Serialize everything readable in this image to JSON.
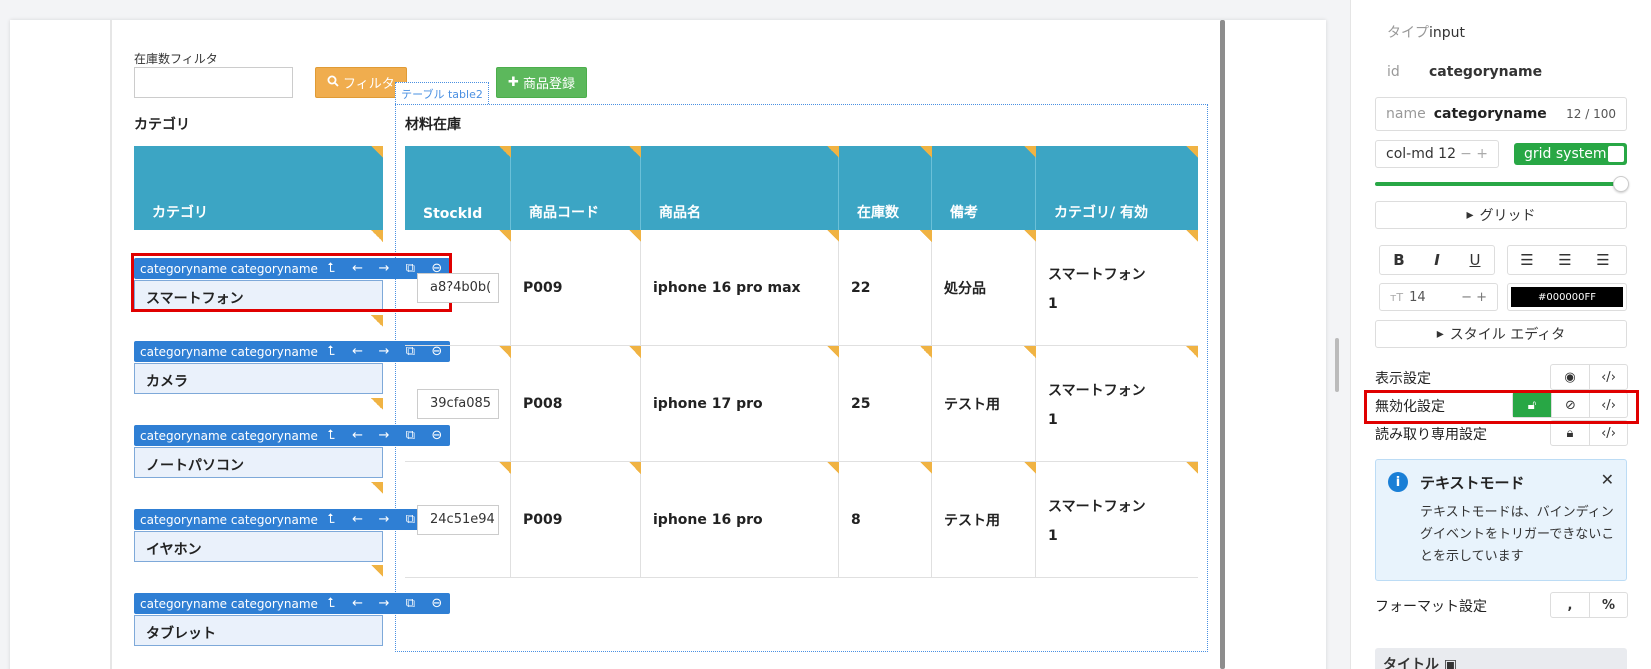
{
  "toolbar_top": {
    "filter_label": "在庫数フィルタ",
    "filter_placeholder": "",
    "filter_button": "フィルタ",
    "register_button": "商品登録",
    "table2_tab": "テーブル table2"
  },
  "category_section": {
    "title": "カテゴリ",
    "header": "カテゴリ",
    "toolbar_name": "categoryname categoryname",
    "items": [
      {
        "label": "スマートフォン"
      },
      {
        "label": "カメラ"
      },
      {
        "label": "ノートパソコン"
      },
      {
        "label": "イヤホン"
      },
      {
        "label": "タブレット"
      }
    ]
  },
  "material_section": {
    "title": "材料在庫",
    "columns": [
      "StockId",
      "商品コード",
      "商品名",
      "在庫数",
      "備考",
      "カテゴリ/ 有効"
    ],
    "rows": [
      {
        "stock_id": "a8?4b0b(",
        "code": "P009",
        "name": "iphone 16 pro max",
        "qty": "22",
        "note": "処分品",
        "category": "スマートフォン",
        "active": "1"
      },
      {
        "stock_id": "39cfa085",
        "code": "P008",
        "name": "iphone 17 pro",
        "qty": "25",
        "note": "テスト用",
        "category": "スマートフォン",
        "active": "1"
      },
      {
        "stock_id": "24c51e94",
        "code": "P009",
        "name": "iphone 16 pro",
        "qty": "8",
        "note": "テスト用",
        "category": "スマートフォン",
        "active": "1"
      }
    ]
  },
  "sidebar": {
    "type_label": "タイプ",
    "type_value": "input",
    "id_label": "id",
    "id_value": "categoryname",
    "name_label": "name",
    "name_value": "categoryname",
    "name_count": "12 / 100",
    "col_value": "col-md 12",
    "grid_toggle": "grid system",
    "grid_button": "グリッド",
    "font_size": "14",
    "color_value": "#000000FF",
    "style_editor": "スタイル エディタ",
    "display_label": "表示設定",
    "disable_label": "無効化設定",
    "readonly_label": "読み取り専用設定",
    "info_title": "テキストモード",
    "info_text": "テキストモードは、バインディングイベントをトリガーできないことを示しています",
    "format_label": "フォーマット設定",
    "format_comma": ",",
    "format_percent": "%",
    "title_label": "タイトル"
  },
  "colors": {
    "table_header": "#3ca5c4",
    "toolbar_blue": "#2f7fd4",
    "filter_orange": "#f0ad4e",
    "register_green": "#5cb85c",
    "highlight_red": "#e00000"
  }
}
